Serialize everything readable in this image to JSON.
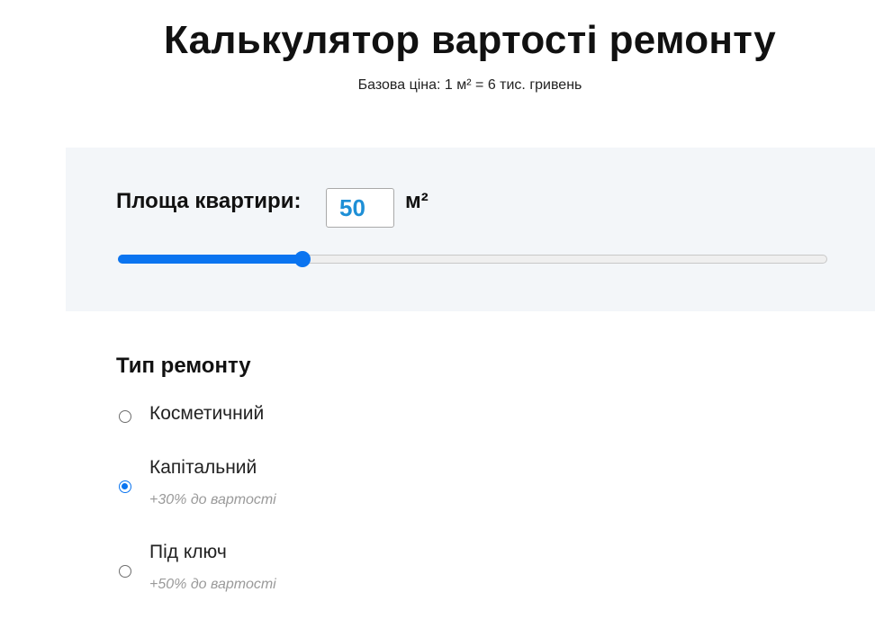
{
  "header": {
    "title": "Калькулятор вартості ремонту",
    "subtitle": "Базова ціна: 1 м² = 6 тис. гривень"
  },
  "area": {
    "label": "Площа квартири:",
    "value": "50",
    "unit": "м²",
    "slider_fraction": 0.26
  },
  "repair_type": {
    "heading": "Тип ремонту",
    "options": [
      {
        "label": "Косметичний",
        "note": "",
        "selected": false
      },
      {
        "label": "Капітальний",
        "note": "+30% до вартості",
        "selected": true
      },
      {
        "label": "Під ключ",
        "note": "+50% до вартості",
        "selected": false
      }
    ]
  },
  "colors": {
    "accent": "#0a74f0",
    "input_value": "#1e8fd6",
    "panel_bg": "#f3f6f9",
    "note_text": "#9a9a9a"
  }
}
